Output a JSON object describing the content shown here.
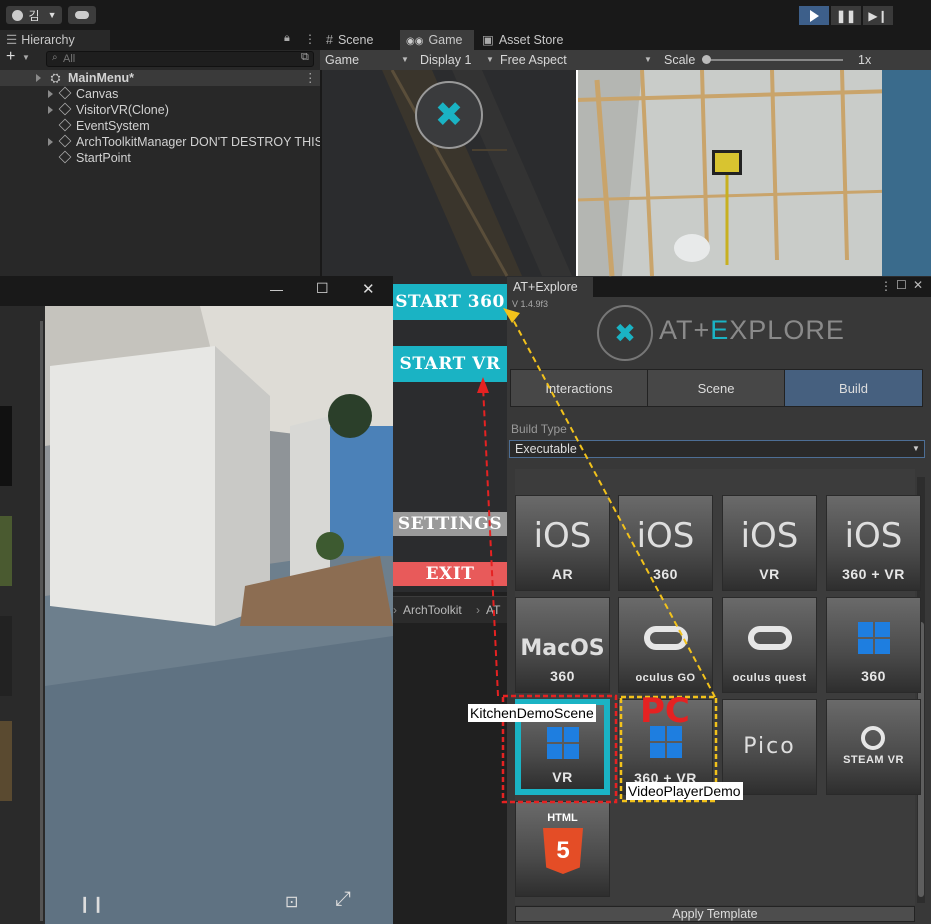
{
  "toolbar": {
    "account_label": "김",
    "account_icon": "person-circle-icon",
    "cloud_icon": "cloud-icon",
    "play_icon": "play-icon",
    "pause_icon": "pause-icon",
    "step_icon": "step-icon"
  },
  "hierarchy": {
    "tab": "Hierarchy",
    "search_placeholder": "All",
    "scene": "MainMenu*",
    "items": [
      {
        "label": "Canvas",
        "expandable": true
      },
      {
        "label": "VisitorVR(Clone)",
        "expandable": true
      },
      {
        "label": "EventSystem",
        "expandable": false
      },
      {
        "label": "ArchToolkitManager DON'T DESTROY THIS",
        "expandable": true
      },
      {
        "label": "StartPoint",
        "expandable": false
      }
    ]
  },
  "game": {
    "tabs": [
      "Scene",
      "Game",
      "Asset Store"
    ],
    "active_tab": "Game",
    "bar": {
      "mode": "Game",
      "display": "Display 1",
      "aspect": "Free Aspect",
      "scale_label": "Scale",
      "scale_value": "1x"
    },
    "menu": {
      "start360": "START 360",
      "startvr": "START VR",
      "settings": "SETTINGS",
      "exit": "EXIT"
    },
    "breadcrumb": [
      "ArchToolkit",
      "AT"
    ]
  },
  "window_controls": {
    "minimize": "—",
    "maximize": "☐",
    "close": "✕"
  },
  "player": {
    "pause_icon": "pause-icon",
    "fit_icon": "fit-screen-icon",
    "fullscreen_icon": "expand-icon"
  },
  "at_panel": {
    "title": "AT+Explore",
    "version": "V 1.4.9f3",
    "logo_text_a": "AT+",
    "logo_text_e": "E",
    "logo_text_b": "XPLORE",
    "tabs": [
      "Interactions",
      "Scene",
      "Build"
    ],
    "active_tab": "Build",
    "build_type_label": "Build Type",
    "build_type_value": "Executable",
    "tiles": [
      {
        "big": "iOS",
        "small": "AR"
      },
      {
        "big": "iOS",
        "small": "360"
      },
      {
        "big": "iOS",
        "small": "VR"
      },
      {
        "big": "iOS",
        "small": "360 + VR"
      },
      {
        "big": "MacOS",
        "small": "360"
      },
      {
        "big": "",
        "small": "oculus GO"
      },
      {
        "big": "",
        "small": "oculus quest"
      },
      {
        "big": "",
        "small": "360"
      },
      {
        "big": "",
        "small": "VR"
      },
      {
        "big": "",
        "small": "360 + VR"
      },
      {
        "big": "Pico",
        "small": ""
      },
      {
        "big": "",
        "small": "STEAM VR"
      },
      {
        "big": "HTML",
        "small": "5"
      }
    ],
    "apply_label": "Apply Template"
  },
  "annotations": {
    "kitchen": "KitchenDemoScene",
    "pc": "PC",
    "video": "VideoPlayerDemo",
    "red": "#e52222",
    "yellow": "#f2c21b"
  },
  "colors": {
    "accent_teal": "#1ab3c4",
    "settings_gray": "#9a9a9a",
    "exit_red": "#e85a5a"
  }
}
